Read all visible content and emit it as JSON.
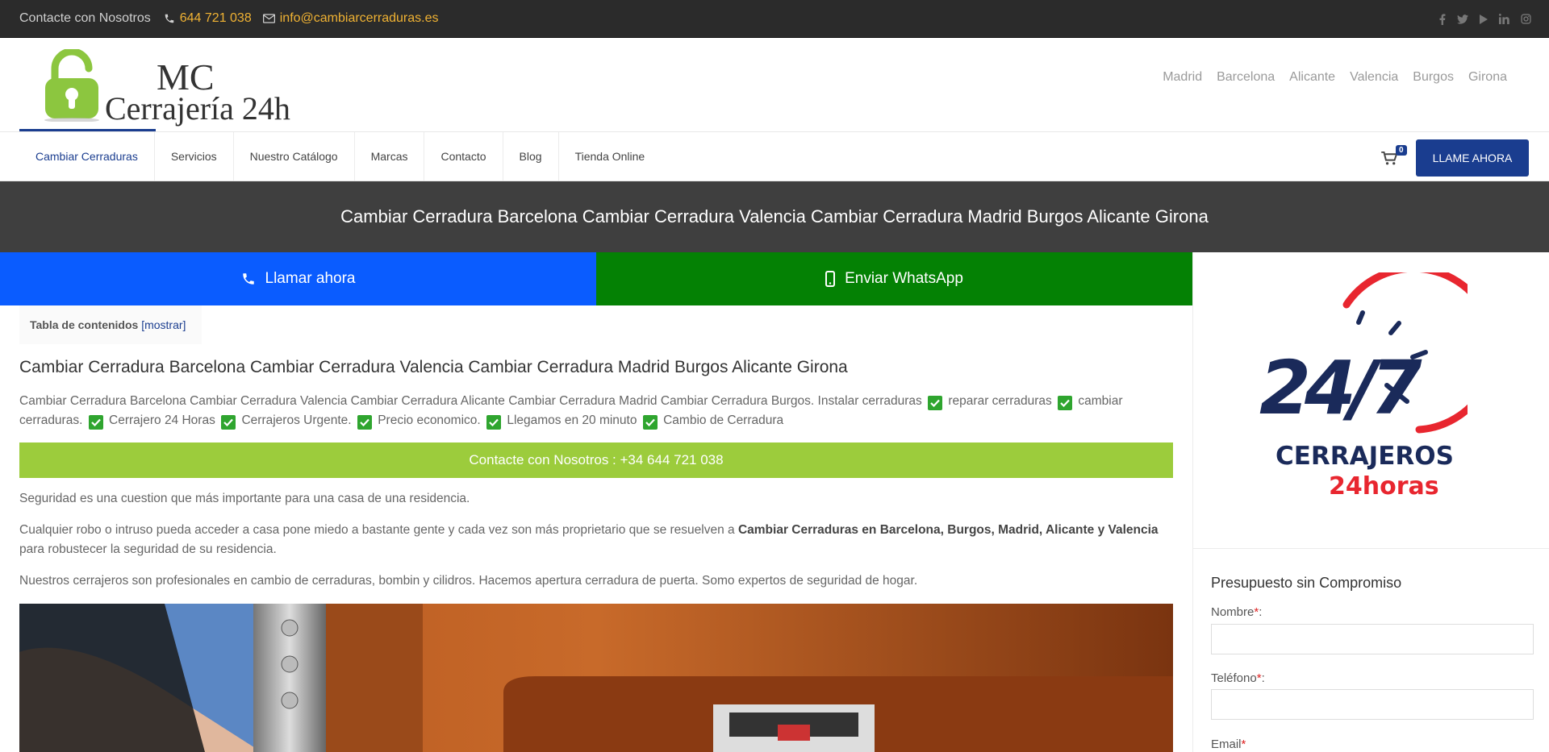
{
  "topbar": {
    "contact_label": "Contacte con Nosotros",
    "phone": "644 721 038",
    "email": "info@cambiarcerraduras.es",
    "social_icons": [
      "facebook-icon",
      "twitter-icon",
      "youtube-icon",
      "linkedin-icon",
      "instagram-icon"
    ]
  },
  "logo": {
    "line1": "MC",
    "line2": "Cerrajería 24h"
  },
  "cities": [
    "Madrid",
    "Barcelona",
    "Alicante",
    "Valencia",
    "Burgos",
    "Girona"
  ],
  "nav": {
    "items": [
      "Cambiar Cerraduras",
      "Servicios",
      "Nuestro Catálogo",
      "Marcas",
      "Contacto",
      "Blog",
      "Tienda Online"
    ],
    "cart_count": "0",
    "call_button": "LLAME AHORA"
  },
  "title_band": "Cambiar Cerradura Barcelona Cambiar Cerradura Valencia Cambiar Cerradura Madrid Burgos Alicante Girona",
  "cta": {
    "call": "Llamar ahora",
    "whatsapp": "Enviar WhatsApp"
  },
  "toc": {
    "label": "Tabla de contenidos",
    "toggle": "[mostrar]"
  },
  "article": {
    "heading": "Cambiar Cerradura Barcelona Cambiar Cerradura Valencia Cambiar Cerradura Madrid Burgos Alicante Girona",
    "intro_lead": "Cambiar Cerradura Barcelona Cambiar Cerradura Valencia Cambiar Cerradura Alicante Cambiar Cerradura Madrid Cambiar Cerradura Burgos. Instalar cerraduras",
    "intro_items": [
      "reparar cerraduras",
      "cambiar cerraduras.",
      "Cerrajero 24 Horas",
      "Cerrajeros Urgente.",
      "Precio economico.",
      "Llegamos en 20 minuto",
      "Cambio de Cerradura"
    ],
    "contact_bar": "Contacte con Nosotros : +34 644 721 038",
    "p1": "Seguridad es una cuestion que más importante para una casa de una residencia.",
    "p2_start": "Cualquier robo o intruso pueda acceder a casa pone miedo a bastante gente y cada vez son más proprietario que se resuelven a ",
    "p2_bold": "Cambiar Cerraduras en Barcelona, Burgos, Madrid, Alicante y Valencia",
    "p2_end": " para robustecer la seguridad de su residencia.",
    "p3": "Nuestros cerrajeros son profesionales en cambio de cerraduras, bombin y cilidros. Hacemos apertura cerradura de puerta. Somo expertos de seguridad de hogar."
  },
  "sidebar": {
    "badge_number": "24/7",
    "badge_word1": "CERRAJEROS",
    "badge_word2": "24horas",
    "form_title": "Presupuesto sin Compromiso",
    "fields": [
      {
        "label": "Nombre",
        "required": "*"
      },
      {
        "label": "Teléfono",
        "required": "*"
      },
      {
        "label": "Email",
        "required": "*"
      }
    ]
  },
  "colors": {
    "navy": "#1a3d8f",
    "call_blue": "#0a5cff",
    "whatsapp_green": "#048104",
    "lime": "#9ccc3c",
    "badge_red": "#e8262f"
  }
}
